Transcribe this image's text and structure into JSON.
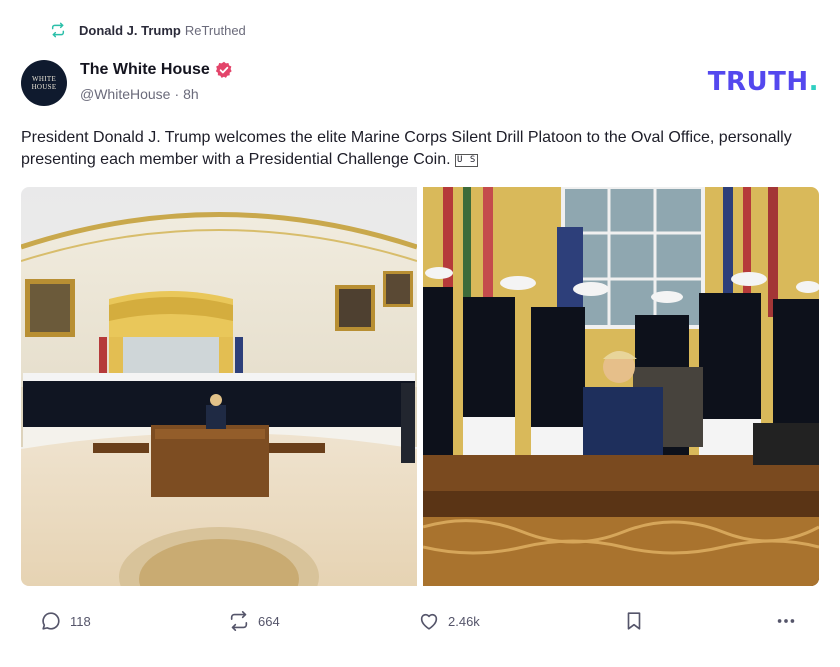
{
  "retruth": {
    "user": "Donald J. Trump",
    "label": "ReTruthed"
  },
  "author": {
    "display_name": "The White House",
    "handle": "@WhiteHouse",
    "separator": "·",
    "time": "8h",
    "verified": true,
    "avatar_text": "WHITE HOUSE"
  },
  "brand": {
    "logo_text": "TRUTH",
    "logo_dot": ".",
    "accent": "#5448ee",
    "dot_color": "#2fcfc1"
  },
  "post": {
    "text": "President Donald J. Trump welcomes the elite Marine Corps Silent Drill Platoon to the Oval Office, personally presenting each member with a Presidential Challenge Coin.",
    "emoji": "U S"
  },
  "actions": {
    "replies": "118",
    "retruths": "664",
    "likes": "2.46k"
  },
  "icons": {
    "retruth": "retruth-icon",
    "verified": "verified-badge-icon",
    "reply": "reply-icon",
    "like": "heart-icon",
    "save": "bookmark-icon",
    "more": "more-icon"
  }
}
